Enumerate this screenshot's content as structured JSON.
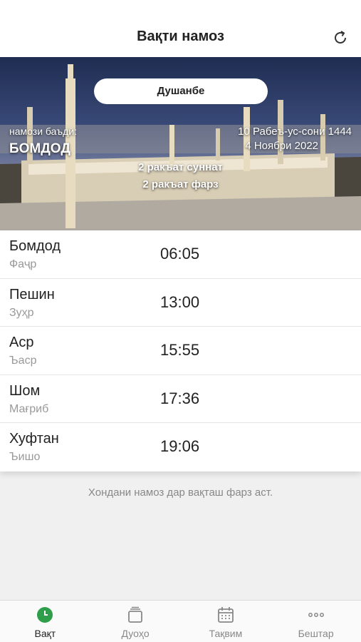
{
  "header": {
    "title": "Вақти намоз",
    "refresh_icon": "refresh-icon"
  },
  "hero": {
    "day": "Душанбе",
    "next_label": "намози баъдӣ:",
    "next_name": "БОМДОД",
    "hijri_date": "10 Рабеъ-ус-сони 1444",
    "greg_date": "4 Ноябри 2022",
    "rakat_sunnat": "2 ракъат суннат",
    "rakat_farz": "2 ракъат фарз"
  },
  "prayers": [
    {
      "name": "Бомдод",
      "alt": "Фаҷр",
      "time": "06:05"
    },
    {
      "name": "Пешин",
      "alt": "Зуҳр",
      "time": "13:00"
    },
    {
      "name": "Аср",
      "alt": "Ъаср",
      "time": "15:55"
    },
    {
      "name": "Шом",
      "alt": "Мағриб",
      "time": "17:36"
    },
    {
      "name": "Хуфтан",
      "alt": "Ъишо",
      "time": "19:06"
    }
  ],
  "footnote": "Хондани намоз дар вақташ фарз аст.",
  "tabs": [
    {
      "label": "Вақт",
      "icon": "clock-icon",
      "active": true
    },
    {
      "label": "Дуоҳо",
      "icon": "book-icon",
      "active": false
    },
    {
      "label": "Тақвим",
      "icon": "calendar-icon",
      "active": false
    },
    {
      "label": "Бештар",
      "icon": "more-icon",
      "active": false
    }
  ],
  "colors": {
    "accent": "#2e9e4a",
    "inactive": "#888888"
  }
}
